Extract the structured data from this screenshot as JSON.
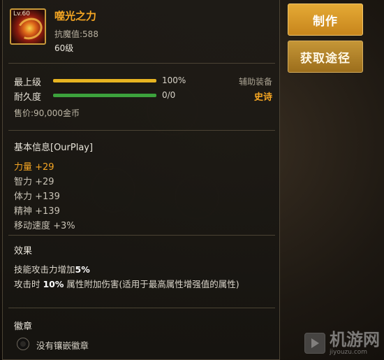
{
  "item": {
    "name": "噬光之力",
    "resistance": "抗魔值:588",
    "level": "60级",
    "icon_level": "Lv.60",
    "icon": "item-orb-icon"
  },
  "stats": {
    "top_level": {
      "label": "最上级",
      "value": "100%",
      "fill": 1.0
    },
    "durability": {
      "label": "耐久度",
      "value": "0/0",
      "fill": 1.0
    }
  },
  "category": "辅助装备",
  "rarity": "史诗",
  "price": "售价:90,000金币",
  "basic_info": {
    "title": "基本信息[OurPlay]",
    "attributes": [
      {
        "text": "力量 +29",
        "highlight": true
      },
      {
        "text": "智力 +29",
        "highlight": false
      },
      {
        "text": "体力 +139",
        "highlight": false
      },
      {
        "text": "精神 +139",
        "highlight": false
      },
      {
        "text": "移动速度 +3%",
        "highlight": false
      }
    ]
  },
  "effects": {
    "title": "效果",
    "line1_prefix": "技能攻击力增加",
    "line1_value": "5%",
    "line2_prefix": "攻击时 ",
    "line2_value": "10%",
    "line2_suffix": " 属性附加伤害(适用于最高属性增强值的属性)"
  },
  "emblem": {
    "title": "徽章",
    "empty_text": "没有镶嵌徽章",
    "icon": "empty-socket-icon"
  },
  "buttons": {
    "make": "制作",
    "source": "获取途径"
  },
  "watermark": {
    "title": "机游网",
    "url": "jiyouzu.com",
    "icon": "play-icon"
  },
  "colors": {
    "gold": "#f5a623",
    "bar_top_level": "#e7b421",
    "bar_durability": "#3ca23c"
  }
}
